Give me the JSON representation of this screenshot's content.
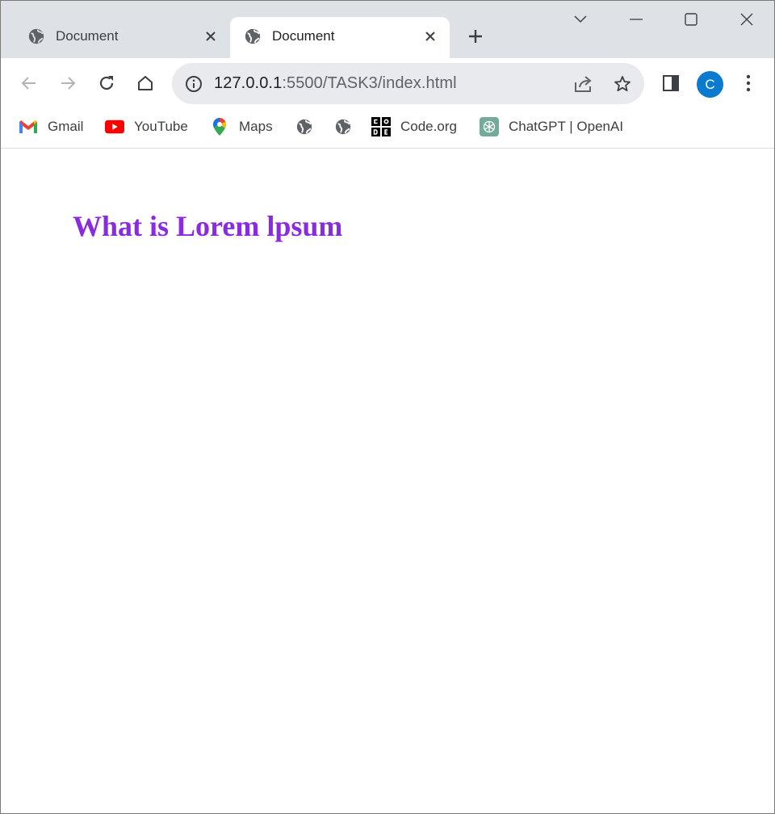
{
  "browser": {
    "tabs": [
      {
        "title": "Document",
        "active": false
      },
      {
        "title": "Document",
        "active": true
      }
    ],
    "address_bar": {
      "host": "127.0.0.1",
      "path": ":5500/TASK3/index.html"
    },
    "profile_initial": "C",
    "bookmarks": [
      {
        "label": "Gmail",
        "icon": "gmail-icon"
      },
      {
        "label": "YouTube",
        "icon": "youtube-icon"
      },
      {
        "label": "Maps",
        "icon": "maps-icon"
      },
      {
        "label": "",
        "icon": "globe-icon"
      },
      {
        "label": "",
        "icon": "globe-icon"
      },
      {
        "label": "Code.org",
        "icon": "code-org-icon"
      },
      {
        "label": "ChatGPT | OpenAI",
        "icon": "chatgpt-icon"
      }
    ]
  },
  "page": {
    "heading": "What is Lorem lpsum"
  },
  "colors": {
    "heading": "#8a2be2",
    "tabstrip": "#dee1e6",
    "omnibox": "#e8eaed",
    "avatar": "#0b7bd0"
  }
}
